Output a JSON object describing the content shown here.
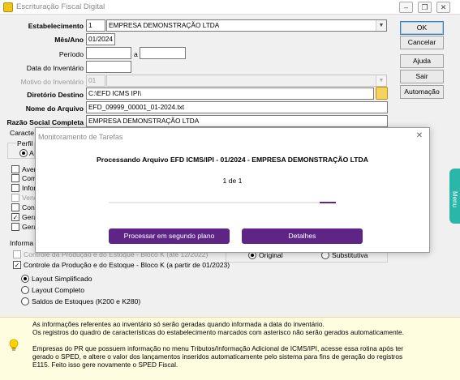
{
  "window": {
    "title": "Escrituração Fiscal Digital",
    "controls": {
      "minimize": "–",
      "restore": "❐",
      "close": "✕"
    }
  },
  "form": {
    "estabelecimento_label": "Estabelecimento",
    "estabelecimento_code": "1",
    "estabelecimento_name": "EMPRESA DEMONSTRAÇÃO LTDA",
    "mes_ano_label": "Mês/Ano",
    "mes_ano_value": "01/2024",
    "periodo_label": "Período",
    "periodo_sep": "a",
    "data_inventario_label": "Data do Inventário",
    "motivo_inventario_label": "Motivo do Inventário",
    "motivo_inventario_code": "01",
    "diretorio_label": "Diretório Destino",
    "diretorio_value": "C:\\EFD ICMS IPI\\",
    "nome_arquivo_label": "Nome do Arquivo",
    "nome_arquivo_value": "EFD_09999_00001_01-2024.txt",
    "razao_social_label": "Razão Social Completa",
    "razao_social_value": "EMPRESA DEMONSTRAÇÃO LTDA"
  },
  "buttons": {
    "ok": "OK",
    "cancelar": "Cancelar",
    "ajuda": "Ajuda",
    "sair": "Sair",
    "automacao": "Automação"
  },
  "background_fragments": {
    "caracteristicas": "Caracte",
    "perfil": "Perfil",
    "perfil_a": "A",
    "items": [
      "Aver",
      "Com",
      "Infor",
      "Vend",
      "Cont",
      "Gera",
      "Gera"
    ],
    "informacoes": "Informa"
  },
  "producao": {
    "bloco_k_ate": "Controle da Produção e do Estoque - Bloco K (até 12/2022)",
    "bloco_k_apartir": "Controle da Produção e do Estoque - Bloco K (a partir de 01/2023)",
    "layout_simplificado": "Layout Simplificado",
    "layout_completo": "Layout Completo",
    "saldos_estoques": "Saldos de Estoques (K200 e K280)"
  },
  "finalidade": {
    "original": "Original",
    "substitutiva": "Substitutiva"
  },
  "dialog": {
    "title": "Monitoramento de Tarefas",
    "message": "Processando Arquivo EFD ICMS/IPI - 01/2024 - EMPRESA DEMONSTRAÇÃO LTDA",
    "counter": "1 de 1",
    "progress": 0.07,
    "btn_background": "Processar em segundo plano",
    "btn_details": "Detalhes",
    "accent": "#5e2587"
  },
  "info": {
    "line1": "As informações referentes ao inventário só serão geradas quando informada a data do inventário.",
    "line2": "Os registros do quadro de características do estabelecimento marcados com asterisco não serão gerados automaticamente.",
    "line3": "Empresas do PR que possuem informação no menu Tributos/Informação Adicional de ICMS/IPI, acesse essa rotina após ter",
    "line4": "gerado o SPED, e altere o valor dos lançamentos inseridos automaticamente pelo sistema para fins de geração do registros",
    "line5": "E115. Feito isso gere novamente o SPED Fiscal.",
    "icon": "lightbulb-icon"
  },
  "side_tab": {
    "label": "Menu",
    "color": "#2ab7a9"
  }
}
